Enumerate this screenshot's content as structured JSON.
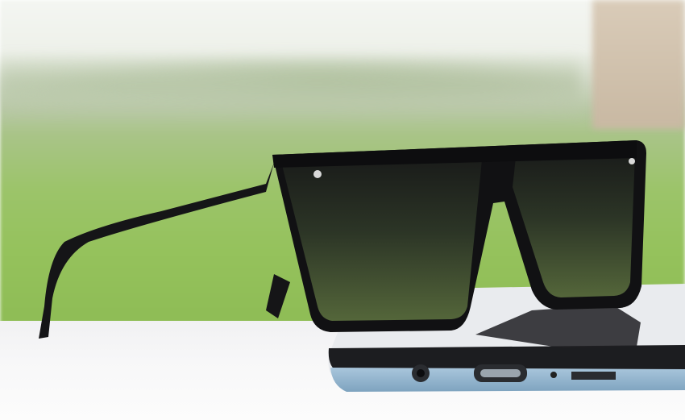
{
  "image": {
    "subject": "sunglasses-on-phone",
    "colors": {
      "field": "#95c25c",
      "sky": "#f4f6f2",
      "table": "#f5f5f6",
      "frame": "#121214",
      "lens": "#3d4a30",
      "phone_edge": "#8fb4cf"
    }
  }
}
